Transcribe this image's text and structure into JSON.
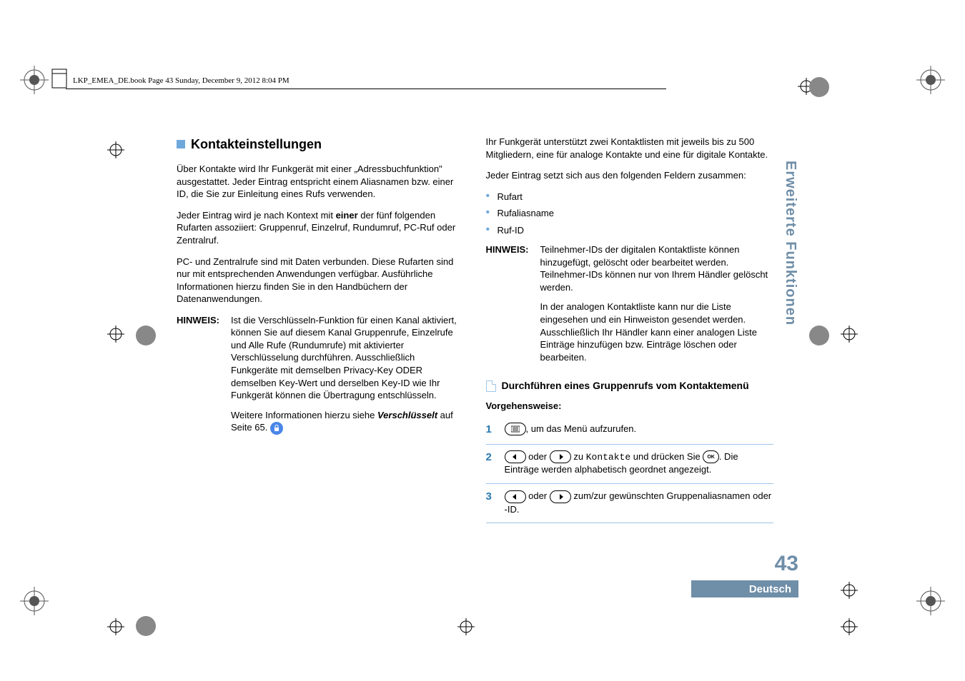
{
  "header": "LKP_EMEA_DE.book  Page 43  Sunday, December 9, 2012  8:04 PM",
  "sideTab": "Erweiterte Funktionen",
  "pageNumber": "43",
  "language": "Deutsch",
  "left": {
    "title": "Kontakteinstellungen",
    "p1": "Über Kontakte wird Ihr Funkgerät mit einer „Adressbuchfunktion\" ausgestattet. Jeder Eintrag entspricht einem Aliasnamen bzw. einer ID, die Sie zur Einleitung eines Rufs verwenden.",
    "p2a": "Jeder Eintrag wird je nach Kontext mit ",
    "p2b": "einer",
    "p2c": " der fünf folgenden Rufarten assoziiert: Gruppenruf, Einzelruf, Rundumruf, PC-Ruf oder Zentralruf.",
    "p3": "PC- und Zentralrufe sind mit Daten verbunden. Diese Rufarten sind nur mit entsprechenden Anwendungen verfügbar. Ausführliche Informationen hierzu finden Sie in den Handbüchern der Datenanwendungen.",
    "hinweisLabel": "HINWEIS:",
    "h1": "Ist die Verschlüsseln-Funktion für einen Kanal aktiviert, können Sie auf diesem Kanal Gruppenrufe, Einzelrufe und Alle Rufe (Rundumrufe) mit aktivierter Verschlüsselung durchführen. Ausschließlich Funkgeräte mit demselben Privacy-Key ODER demselben Key-Wert und derselben Key-ID wie Ihr Funkgerät können die Übertragung entschlüsseln.",
    "h2a": "Weitere Informationen hierzu siehe ",
    "h2b": "Verschlüsselt",
    "h2c": " auf Seite 65."
  },
  "right": {
    "p1": "Ihr Funkgerät unterstützt zwei Kontaktlisten mit jeweils bis zu 500 Mitgliedern, eine für analoge Kontakte und eine für digitale Kontakte.",
    "p2": "Jeder Eintrag setzt sich aus den folgenden Feldern zusammen:",
    "bullets": [
      "Rufart",
      "Rufaliasname",
      "Ruf-ID"
    ],
    "hinweisLabel": "HINWEIS:",
    "h1": "Teilnehmer-IDs der digitalen Kontaktliste können hinzugefügt, gelöscht oder bearbeitet werden. Teilnehmer-IDs können nur von Ihrem Händler gelöscht werden.",
    "h2": "In der analogen Kontaktliste kann nur die Liste eingesehen und ein Hinweiston gesendet werden. Ausschließlich Ihr Händler kann einer analogen Liste Einträge hinzufügen bzw. Einträge löschen oder bearbeiten.",
    "subTitle": "Durchführen eines Gruppenrufs vom Kontaktemenü",
    "proc": "Vorgehensweise:",
    "steps": {
      "s1": ", um das Menü aufzurufen.",
      "s2a": " oder ",
      "s2b": " zu ",
      "s2c": "Kontakte",
      "s2d": " und drücken Sie ",
      "s2e": ". Die Einträge werden alphabetisch geordnet angezeigt.",
      "s3a": " oder ",
      "s3b": " zum/zur gewünschten Gruppenaliasnamen oder -ID."
    }
  }
}
